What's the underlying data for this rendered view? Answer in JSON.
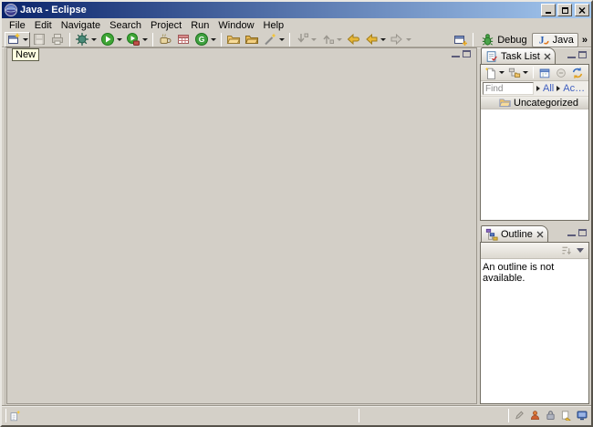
{
  "window": {
    "title": "Java - Eclipse"
  },
  "menu": {
    "items": [
      "File",
      "Edit",
      "Navigate",
      "Search",
      "Project",
      "Run",
      "Window",
      "Help"
    ]
  },
  "toolbar": {
    "tooltip": "New",
    "groups": [
      [
        "new-wizard",
        "save",
        "print"
      ],
      [
        "debug",
        "run",
        "external-tools"
      ],
      [
        "java-cup",
        "web-grid",
        "new-class"
      ],
      [
        "open-folder",
        "open-folder-alt",
        "wand"
      ],
      [
        "next-annotation",
        "previous-annotation",
        "last-edit-location",
        "back",
        "forward"
      ]
    ]
  },
  "perspective_bar": {
    "overflow": "»",
    "items": [
      {
        "label": "Debug",
        "active": false
      },
      {
        "label": "Java",
        "active": true
      }
    ]
  },
  "task_list": {
    "title": "Task List",
    "find": {
      "value": "",
      "placeholder": "Find"
    },
    "links": {
      "all": "All",
      "activate": "Activat..."
    },
    "categories": [
      "Uncategorized"
    ]
  },
  "outline": {
    "title": "Outline",
    "message": "An outline is not available."
  },
  "colors": {
    "chrome": "#d4d0c8",
    "titlebar_gradient_start": "#0b246b",
    "titlebar_gradient_end": "#a5c9f0",
    "editor_background": "#d3cfc7",
    "tooltip_background": "#ffffe1",
    "link": "#3f5fc0",
    "run_green": "#3fa535",
    "nav_arrow_yellow": "#e8b838"
  }
}
